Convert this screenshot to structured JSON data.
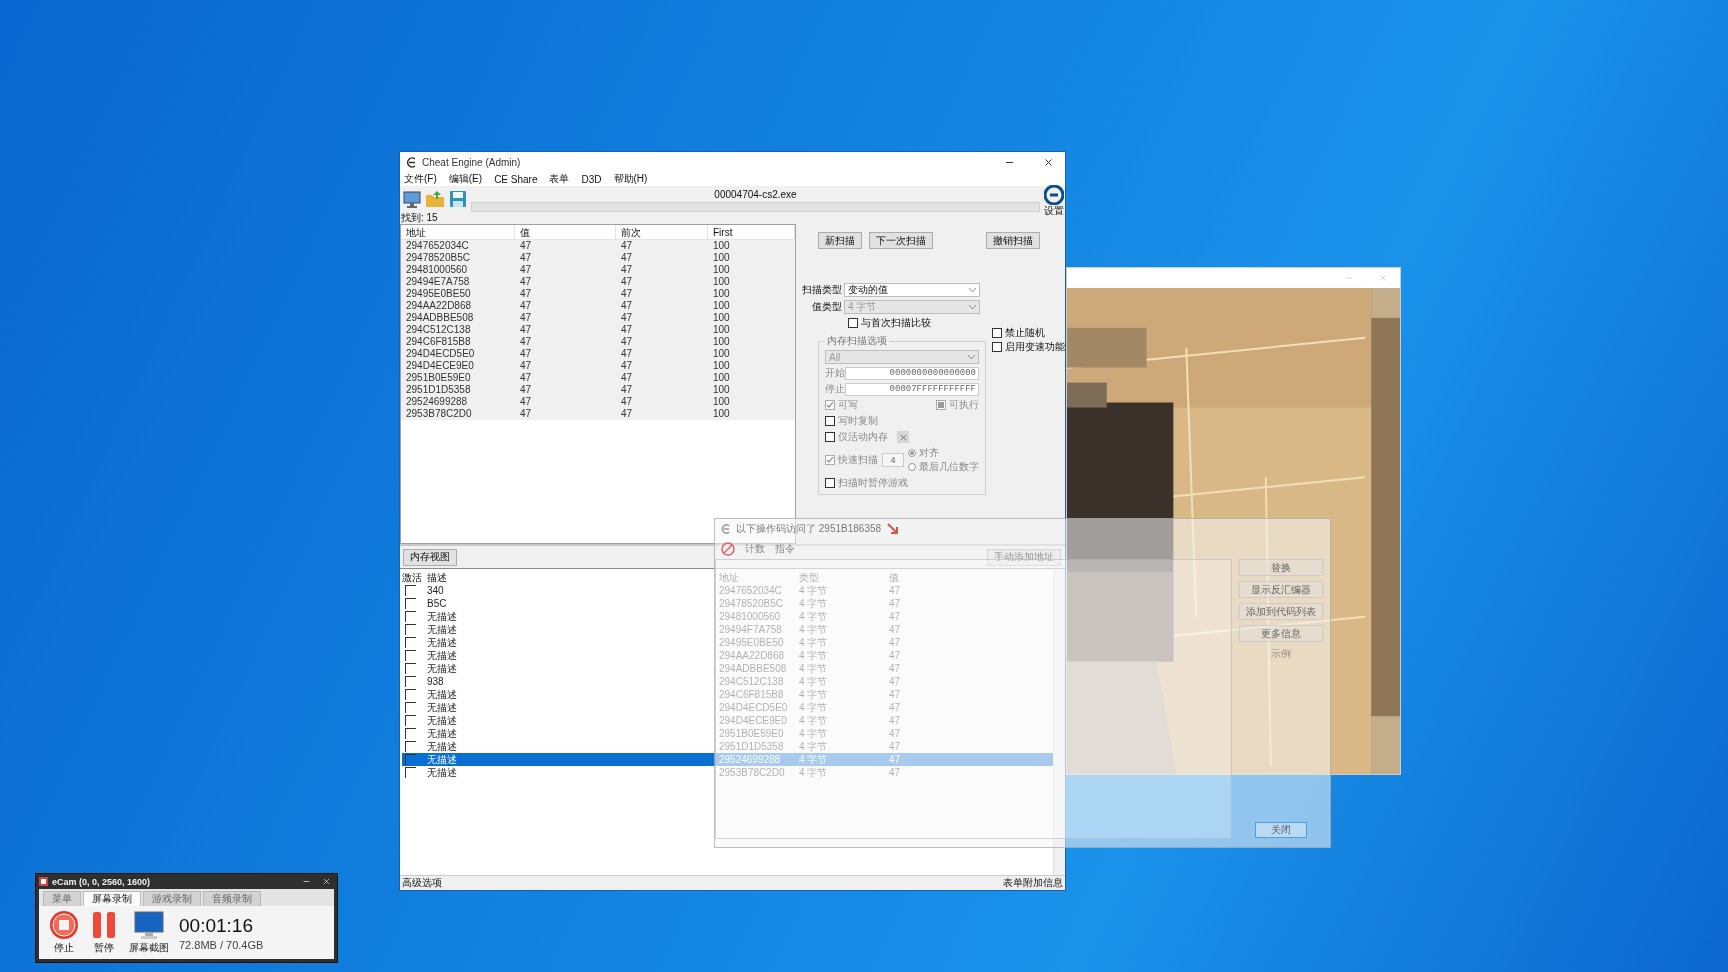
{
  "cheat_engine": {
    "title": "Cheat Engine (Admin)",
    "menu": [
      "文件(F)",
      "编辑(E)",
      "CE Share",
      "表单",
      "D3D",
      "帮助(H)"
    ],
    "process": "00004704-cs2.exe",
    "settings_label": "设置",
    "found": "找到: 15",
    "results": {
      "columns": [
        "地址",
        "值",
        "前次",
        "First"
      ],
      "rows": [
        [
          "2947652034C",
          "47",
          "47",
          "100"
        ],
        [
          "29478520B5C",
          "47",
          "47",
          "100"
        ],
        [
          "29481000560",
          "47",
          "47",
          "100"
        ],
        [
          "29494E7A758",
          "47",
          "47",
          "100"
        ],
        [
          "29495E0BE50",
          "47",
          "47",
          "100"
        ],
        [
          "294AA22D868",
          "47",
          "47",
          "100"
        ],
        [
          "294ADBBE508",
          "47",
          "47",
          "100"
        ],
        [
          "294C512C138",
          "47",
          "47",
          "100"
        ],
        [
          "294C6F815B8",
          "47",
          "47",
          "100"
        ],
        [
          "294D4ECD5E0",
          "47",
          "47",
          "100"
        ],
        [
          "294D4ECE9E0",
          "47",
          "47",
          "100"
        ],
        [
          "2951B0E59E0",
          "47",
          "47",
          "100"
        ],
        [
          "2951D1D5358",
          "47",
          "47",
          "100"
        ],
        [
          "29524699288",
          "47",
          "47",
          "100"
        ],
        [
          "2953B78C2D0",
          "47",
          "47",
          "100"
        ]
      ]
    },
    "scan_buttons": [
      "新扫描",
      "下一次扫描",
      "撤销扫描"
    ],
    "scan_type": {
      "label": "扫描类型",
      "value": "变动的值",
      "disabled": false
    },
    "value_type": {
      "label": "值类型",
      "value": "4 字节",
      "disabled": true
    },
    "compare_first": {
      "label": "与首次扫描比较",
      "checked": false
    },
    "side_options": [
      {
        "label": "禁止随机",
        "checked": false
      },
      {
        "label": "启用变速功能",
        "checked": false
      }
    ],
    "memory_options": {
      "title": "内存扫描选项",
      "region": "All",
      "start_label": "开始",
      "start": "0000000000000000",
      "stop_label": "停止",
      "stop": "00007FFFFFFFFFFF",
      "flags": [
        {
          "label": "可写",
          "kind": "tick",
          "checked": true
        },
        {
          "label": "可执行",
          "kind": "indeterminate",
          "checked": true
        }
      ],
      "copy_on_write": {
        "label": "写时复制",
        "checked": false
      },
      "active_memory": {
        "label": "仅活动内存",
        "checked": false
      },
      "fast_scan": {
        "label": "快速扫描",
        "checked": true,
        "value": "4"
      },
      "alignment": [
        {
          "label": "对齐",
          "selected": true
        },
        {
          "label": "最后几位数字",
          "selected": false
        }
      ],
      "pause_game": {
        "label": "扫描时暂停游戏",
        "checked": false
      }
    },
    "memory_view_button": "内存视图",
    "add_address_button": "手动添加地址",
    "table": {
      "columns": [
        "激活",
        "描述",
        "地址",
        "类型",
        "值"
      ],
      "rows": [
        {
          "active": false,
          "selected": false,
          "description": "340",
          "address": "2947652034C",
          "type": "4 字节",
          "value": "47"
        },
        {
          "active": false,
          "selected": false,
          "description": "B5C",
          "address": "29478520B5C",
          "type": "4 字节",
          "value": "47"
        },
        {
          "active": false,
          "selected": false,
          "description": "无描述",
          "address": "29481000560",
          "type": "4 字节",
          "value": "47"
        },
        {
          "active": false,
          "selected": false,
          "description": "无描述",
          "address": "29494F7A758",
          "type": "4 字节",
          "value": "47"
        },
        {
          "active": false,
          "selected": false,
          "description": "无描述",
          "address": "29495E0BE50",
          "type": "4 字节",
          "value": "47"
        },
        {
          "active": false,
          "selected": false,
          "description": "无描述",
          "address": "294AA22D868",
          "type": "4 字节",
          "value": "47"
        },
        {
          "active": false,
          "selected": false,
          "description": "无描述",
          "address": "294ADBBE508",
          "type": "4 字节",
          "value": "47"
        },
        {
          "active": false,
          "selected": false,
          "description": "938",
          "address": "294C512C138",
          "type": "4 字节",
          "value": "47"
        },
        {
          "active": false,
          "selected": false,
          "description": "无描述",
          "address": "294C6F815B8",
          "type": "4 字节",
          "value": "47"
        },
        {
          "active": false,
          "selected": false,
          "description": "无描述",
          "address": "294D4ECD5E0",
          "type": "4 字节",
          "value": "47"
        },
        {
          "active": false,
          "selected": false,
          "description": "无描述",
          "address": "294D4ECE9E0",
          "type": "4 字节",
          "value": "47"
        },
        {
          "active": false,
          "selected": false,
          "description": "无描述",
          "address": "2951B0E59E0",
          "type": "4 字节",
          "value": "47"
        },
        {
          "active": false,
          "selected": false,
          "description": "无描述",
          "address": "2951D1D5358",
          "type": "4 字节",
          "value": "47"
        },
        {
          "active": false,
          "selected": true,
          "description": "无描述",
          "address": "29524699288",
          "type": "4 字节",
          "value": "47"
        },
        {
          "active": false,
          "selected": false,
          "description": "无描述",
          "address": "2953B78C2D0",
          "type": "4 字节",
          "value": "47"
        }
      ]
    },
    "status_left": "高级选项",
    "status_right": "表单附加信息"
  },
  "dialog": {
    "title": "以下操作码访问了 2951B186358",
    "columns": [
      "计数",
      "指令"
    ],
    "buttons": [
      "替换",
      "显示反汇编器",
      "添加到代码列表",
      "更多信息"
    ],
    "note": "示例",
    "close": "关闭"
  },
  "recorder": {
    "title": "eCam (0, 0, 2560, 1600)",
    "tabs": [
      {
        "label": "菜单",
        "selected": false
      },
      {
        "label": "屏幕录制",
        "selected": true
      },
      {
        "label": "游戏录制",
        "selected": false
      },
      {
        "label": "音频录制",
        "selected": false
      }
    ],
    "buttons": [
      {
        "kind": "stop",
        "label": "停止"
      },
      {
        "kind": "pause",
        "label": "暂停"
      },
      {
        "kind": "screenshot",
        "label": "屏幕截图"
      }
    ],
    "time": "00:01:16",
    "size": "72.8MB / 70.4GB"
  }
}
